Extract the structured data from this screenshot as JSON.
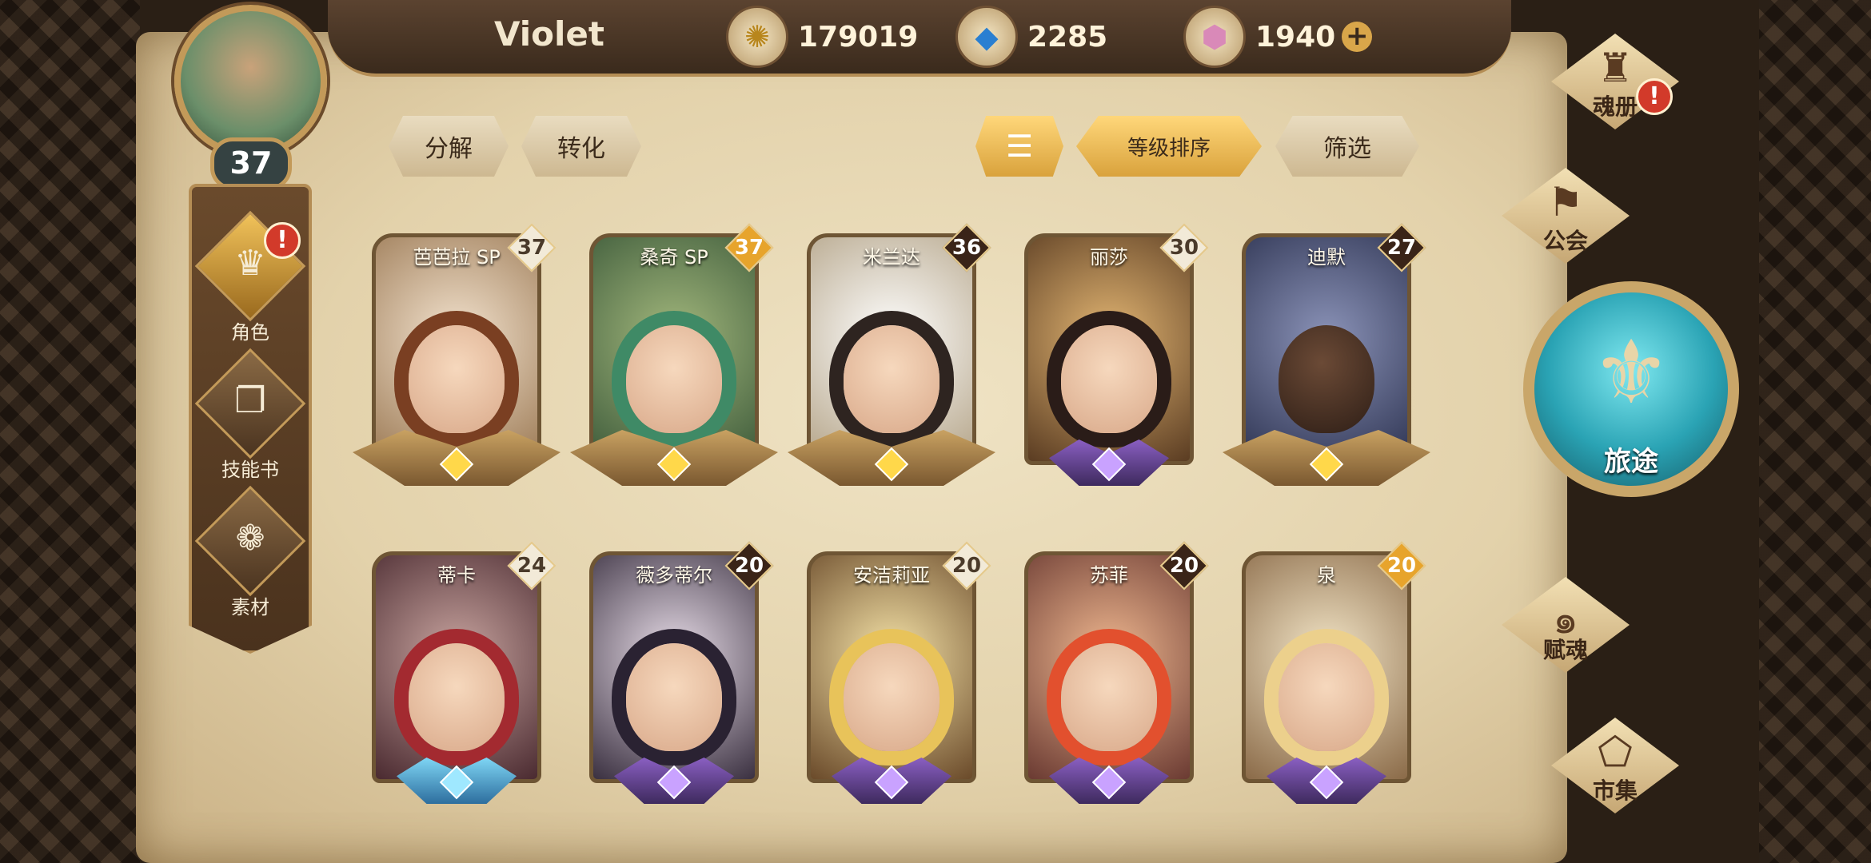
{
  "player": {
    "name": "Violet",
    "level": "37"
  },
  "currencies": [
    {
      "icon": "gold-coin-icon",
      "value": "179019"
    },
    {
      "icon": "blue-crystal-icon",
      "value": "2285"
    },
    {
      "icon": "pink-gem-icon",
      "value": "1940"
    }
  ],
  "plus_symbol": "+",
  "left_nav": {
    "items": [
      {
        "label": "角色",
        "icon": "character-icon",
        "glyph": "♛",
        "active": true,
        "alert": "!"
      },
      {
        "label": "技能书",
        "icon": "skill-book-icon",
        "glyph": "❐",
        "active": false
      },
      {
        "label": "素材",
        "icon": "materials-icon",
        "glyph": "❁",
        "active": false
      }
    ]
  },
  "toolbar": {
    "decompose_label": "分解",
    "convert_label": "转化",
    "sort_icon_glyph": "☰",
    "sort_label": "等级排序",
    "filter_label": "筛选"
  },
  "cards": [
    {
      "name": "芭芭拉 SP",
      "level": "37",
      "badge": "light",
      "rank": "wings"
    },
    {
      "name": "桑奇 SP",
      "level": "37",
      "badge": "gold",
      "rank": "wings"
    },
    {
      "name": "米兰达",
      "level": "36",
      "badge": "dark",
      "rank": "wings"
    },
    {
      "name": "丽莎",
      "level": "30",
      "badge": "light",
      "rank": "purple"
    },
    {
      "name": "迪默",
      "level": "27",
      "badge": "dark",
      "rank": "wings"
    },
    {
      "name": "蒂卡",
      "level": "24",
      "badge": "light",
      "rank": "blue"
    },
    {
      "name": "薇多蒂尔",
      "level": "20",
      "badge": "dark",
      "rank": "purple"
    },
    {
      "name": "安洁莉亚",
      "level": "20",
      "badge": "light",
      "rank": "purple"
    },
    {
      "name": "苏菲",
      "level": "20",
      "badge": "dark",
      "rank": "purple"
    },
    {
      "name": "泉",
      "level": "20",
      "badge": "gold",
      "rank": "purple"
    }
  ],
  "right_menu": {
    "soul_book_label": "魂册",
    "soul_book_alert": "!",
    "guild_label": "公会",
    "journey_label": "旅途",
    "endow_soul_label": "赋魂",
    "market_label": "市集"
  },
  "colors": {
    "accent_gold": "#d9a64a",
    "alert_red": "#d23a2a",
    "parchment": "#e3d2ab"
  }
}
